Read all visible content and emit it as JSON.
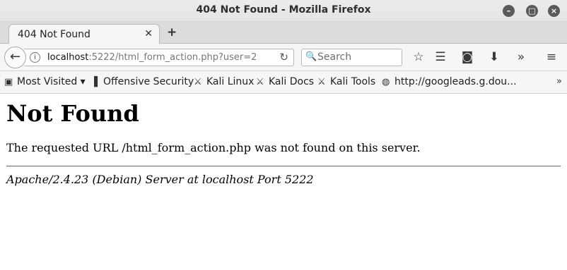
{
  "window": {
    "title": "404 Not Found - Mozilla Firefox"
  },
  "tabs": [
    {
      "label": "404 Not Found"
    }
  ],
  "navbar": {
    "url_host": "localhost",
    "url_rest": ":5222/html_form_action.php?user=2",
    "search_placeholder": "Search"
  },
  "bookmarks": [
    {
      "label": "Most Visited ▾",
      "icon": "folder-icon"
    },
    {
      "label": "Offensive Security",
      "icon": "offsec-icon"
    },
    {
      "label": "Kali Linux",
      "icon": "kali-icon"
    },
    {
      "label": "Kali Docs",
      "icon": "kali-icon"
    },
    {
      "label": "Kali Tools",
      "icon": "kali-icon"
    },
    {
      "label": "http://googleads.g.dou...",
      "icon": "globe-icon"
    }
  ],
  "page": {
    "heading": "Not Found",
    "message": "The requested URL /html_form_action.php was not found on this server.",
    "address": "Apache/2.4.23 (Debian) Server at localhost Port 5222"
  }
}
